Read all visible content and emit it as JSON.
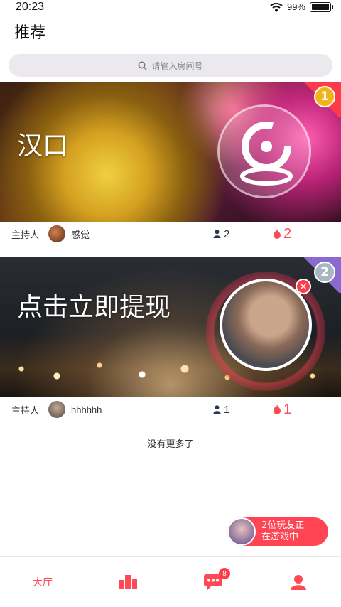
{
  "status_bar": {
    "time": "20:23",
    "battery": "99%",
    "battery_level": 0.99,
    "icons": [
      "wifi-icon",
      "battery-icon"
    ]
  },
  "header": {
    "title": "推荐"
  },
  "search": {
    "placeholder": "请输入房间号",
    "icon": "search-icon"
  },
  "rooms": [
    {
      "title": "汉口",
      "rank": "1",
      "host_label": "主持人",
      "host_name": "感觉",
      "listeners": "2",
      "heat": "2"
    },
    {
      "title": "点击立即提现",
      "rank": "2",
      "host_label": "主持人",
      "host_name": "hhhhhh",
      "listeners": "1",
      "heat": "1"
    }
  ],
  "list_footer": "没有更多了",
  "float_banner": {
    "line1": "2位玩友正",
    "line2": "在游戏中"
  },
  "tabbar": {
    "items": [
      {
        "label": "大厅",
        "icon": "hall-text"
      },
      {
        "label": "",
        "icon": "ranking-icon"
      },
      {
        "label": "",
        "icon": "message-icon",
        "badge": "8"
      },
      {
        "label": "",
        "icon": "profile-icon"
      }
    ]
  },
  "colors": {
    "accent": "#ff4a55",
    "search_bg": "#ece9ee"
  }
}
